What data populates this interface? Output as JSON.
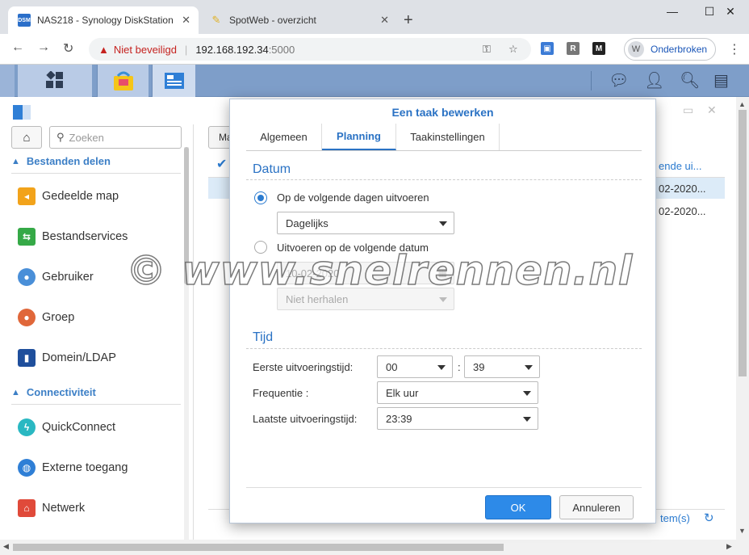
{
  "browser": {
    "tabs": [
      {
        "title": "NAS218 - Synology DiskStation",
        "favicon": "DSM",
        "active": true
      },
      {
        "title": "SpotWeb - overzicht",
        "favicon": "pencil-icon",
        "active": false
      }
    ],
    "security_label": "Niet beveiligd",
    "url_host": "192.168.192.34",
    "url_port": ":5000",
    "profile_initial": "W",
    "profile_label": "Onderbroken",
    "extensions": [
      "R"
    ]
  },
  "dsm_taskbar": {
    "colors": {
      "bar": "#7e9ec9"
    }
  },
  "control_panel": {
    "search_placeholder": "Zoeken",
    "sections": [
      {
        "title": "Bestanden delen",
        "items": [
          {
            "label": "Gedeelde map",
            "icon": "shared-folder-icon",
            "color": "#f2a31b"
          },
          {
            "label": "Bestandservices",
            "icon": "file-services-icon",
            "color": "#35a947"
          },
          {
            "label": "Gebruiker",
            "icon": "user-icon",
            "color": "#4a8fd8"
          },
          {
            "label": "Groep",
            "icon": "group-icon",
            "color": "#e0673a"
          },
          {
            "label": "Domein/LDAP",
            "icon": "domain-icon",
            "color": "#1f4f9c"
          }
        ]
      },
      {
        "title": "Connectiviteit",
        "items": [
          {
            "label": "QuickConnect",
            "icon": "quickconnect-icon",
            "color": "#2ab8c2"
          },
          {
            "label": "Externe toegang",
            "icon": "globe-icon",
            "color": "#2f7fd6"
          },
          {
            "label": "Netwerk",
            "icon": "network-icon",
            "color": "#e04a3a"
          }
        ]
      }
    ],
    "background": {
      "toolbar_btn": "Ma",
      "col_header": "ende ui...",
      "row1_date": "02-2020...",
      "row2_date": "02-2020...",
      "items_label": "tem(s)"
    }
  },
  "dialog": {
    "title": "Een taak bewerken",
    "tabs": [
      "Algemeen",
      "Planning",
      "Taakinstellingen"
    ],
    "active_tab": "Planning",
    "date_section": {
      "title": "Datum",
      "option1_label": "Op de volgende dagen uitvoeren",
      "option1_value": "Dagelijks",
      "option2_label": "Uitvoeren op de volgende datum",
      "option2_date": "10-02-2020",
      "option2_repeat": "Niet herhalen",
      "selected": 1
    },
    "time_section": {
      "title": "Tijd",
      "first_run_label": "Eerste uitvoeringstijd:",
      "first_run_hour": "00",
      "first_run_minute": "39",
      "frequency_label": "Frequentie :",
      "frequency_value": "Elk uur",
      "last_run_label": "Laatste uitvoeringstijd:",
      "last_run_value": "23:39"
    },
    "ok_label": "OK",
    "cancel_label": "Annuleren"
  },
  "watermark": "© www.snelrennen.nl"
}
